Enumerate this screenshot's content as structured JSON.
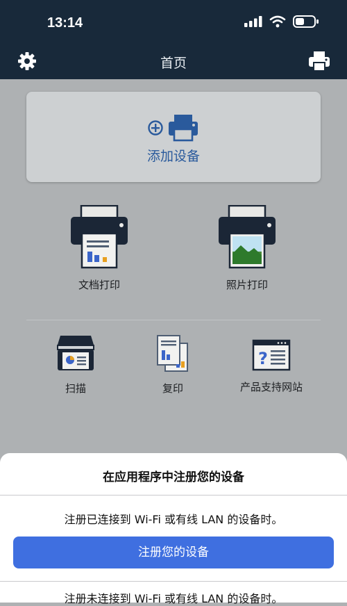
{
  "status": {
    "time": "13:14",
    "signal_icon": "cellular-signal-icon",
    "wifi_icon": "wifi-icon",
    "battery_icon": "battery-icon"
  },
  "nav": {
    "title": "首页",
    "left_icon": "gear-icon",
    "right_icon": "printer-icon"
  },
  "add_device": {
    "label": "添加设备",
    "icon": "add-printer-icon",
    "accent": "#2a5a9c"
  },
  "primary_actions": [
    {
      "label": "文档打印",
      "icon": "document-print-icon"
    },
    {
      "label": "照片打印",
      "icon": "photo-print-icon"
    }
  ],
  "secondary_actions": [
    {
      "label": "扫描",
      "icon": "scanner-icon"
    },
    {
      "label": "复印",
      "icon": "copy-icon"
    },
    {
      "label": "产品支持网站",
      "icon": "support-website-icon"
    }
  ],
  "sheet": {
    "title": "在应用程序中注册您的设备",
    "description": "注册已连接到 Wi-Fi 或有线 LAN 的设备时。",
    "register_button": "注册您的设备",
    "description_2": "注册未连接到 Wi-Fi 或有线 LAN 的设备时。",
    "button_color": "#3f6fe0"
  },
  "colors": {
    "header": "#18293a",
    "background": "#aeb1b3"
  }
}
